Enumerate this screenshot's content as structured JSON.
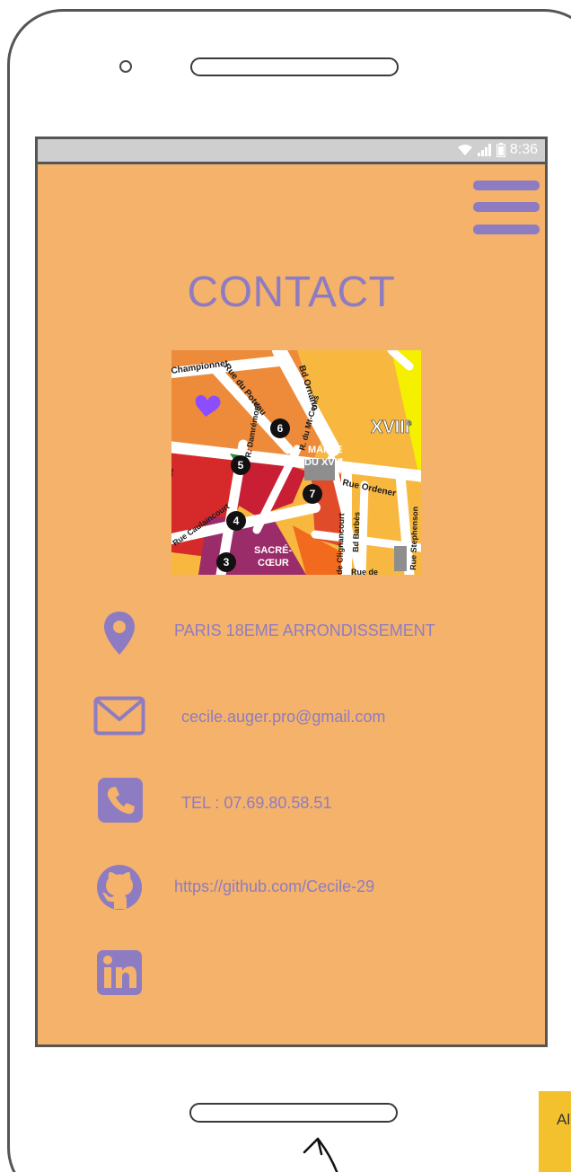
{
  "status_bar": {
    "time": "8:36",
    "wifi_icon": "wifi-icon",
    "signal_icon": "signal-icon",
    "battery_icon": "battery-icon"
  },
  "header": {
    "menu_icon": "hamburger-menu-icon"
  },
  "page": {
    "title": "CONTACT"
  },
  "map": {
    "labels": {
      "championnet": "Championnet",
      "poteau": "Rue du Poteau",
      "ornano": "Bd Ornano",
      "arrondissement": "XVIII",
      "arrondissement_sup": "e",
      "mairie_1": "MAIRIE",
      "mairie_2": "DU XVIII",
      "mairie_sup": "e",
      "ordener": "Rue Ordener",
      "damremont": "R. Damrémont",
      "mtcenis": "R. du Mt-Cenis",
      "caulaincourt": "Rue Caulaincourt",
      "clignancourt": "de Clignancourt",
      "barbes": "Bd Barbès",
      "stephenson": "Rue Stephenson",
      "sacre_1": "SACRÉ-",
      "sacre_2": "CŒUR",
      "rue_de": "Rue de",
      "rck": "rck"
    },
    "markers": [
      "3",
      "4",
      "5",
      "6",
      "7"
    ]
  },
  "contacts": [
    {
      "icon": "location-pin-icon",
      "text": "PARIS 18EME ARRONDISSEMENT"
    },
    {
      "icon": "envelope-icon",
      "text": "cecile.auger.pro@gmail.com"
    },
    {
      "icon": "phone-icon",
      "text": "TEL : 07.69.80.58.51"
    },
    {
      "icon": "github-icon",
      "text": "https://github.com/Cecile-29"
    },
    {
      "icon": "linkedin-icon",
      "text": ""
    }
  ],
  "corner_tab": {
    "label": "Al"
  },
  "colors": {
    "background": "#F4B26B",
    "accent": "#8E7CC3",
    "status_bar": "#CFCFCF",
    "frame": "#555555",
    "corner_tab": "#F3C12E"
  }
}
